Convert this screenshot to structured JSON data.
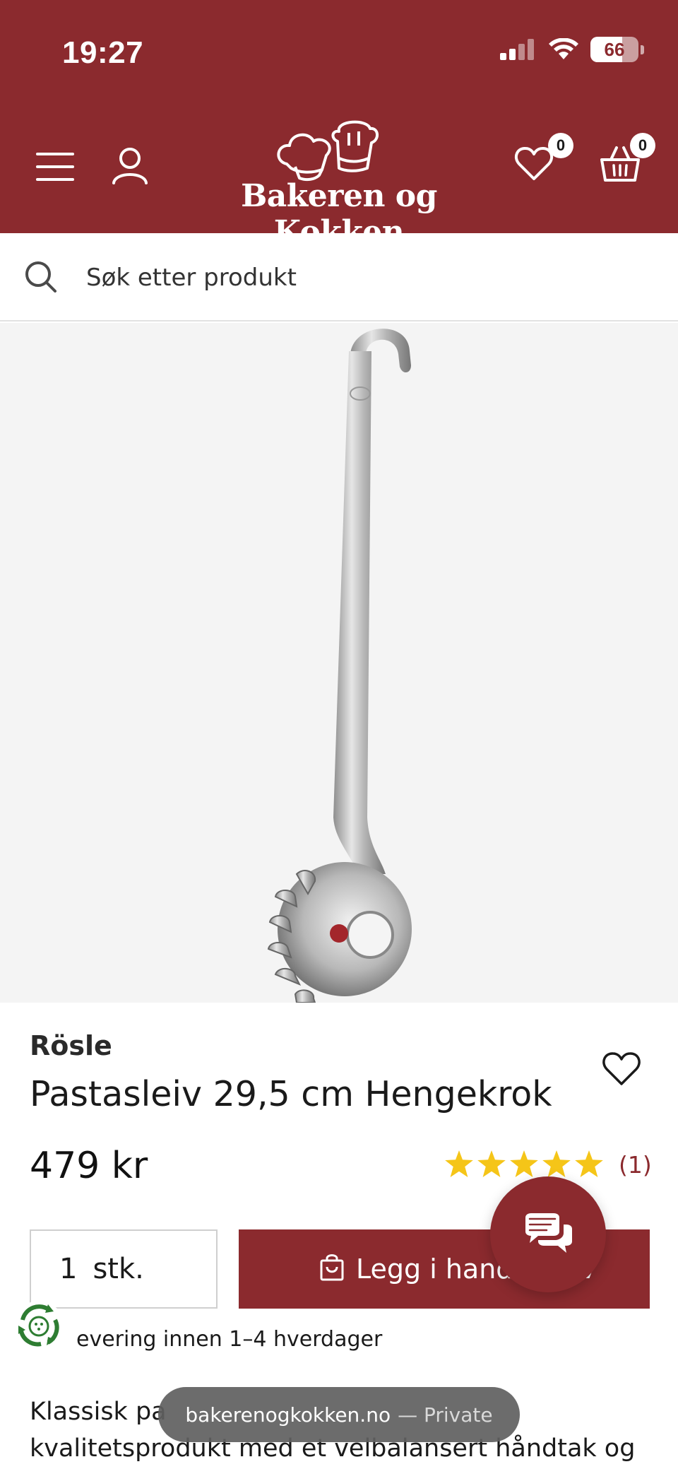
{
  "status_bar": {
    "time": "19:27",
    "battery": "66",
    "battery_level": 0.66
  },
  "header": {
    "logo_text": "Bakeren og Kokken",
    "wishlist_count": "0",
    "cart_count": "0",
    "icons": [
      "menu-icon",
      "account-icon",
      "chef-hats-logo",
      "heart-icon",
      "basket-icon"
    ]
  },
  "search": {
    "placeholder": "Søk etter produkt"
  },
  "product": {
    "brand": "Rösle",
    "title": "Pastasleiv 29,5 cm Hengekrok",
    "price": "479 kr",
    "rating": 5,
    "rating_max": 5,
    "review_count": "(1)",
    "quantity": "1",
    "quantity_unit": "stk.",
    "add_to_cart_label": "Legg i handlekurv",
    "delivery_text": "evering innen 1–4 hverdager",
    "description": "Klassisk pa                                        kvalitetsprodukt med et velbalansert håndtak og"
  },
  "browser": {
    "domain": "bakerenogkokken.no",
    "mode": "— Private"
  },
  "colors": {
    "brand": "#8b2a2e",
    "star": "#f5c518",
    "image_bg": "#f4f4f4"
  }
}
